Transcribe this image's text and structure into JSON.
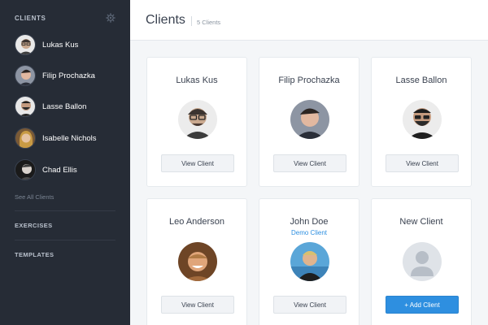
{
  "sidebar": {
    "title": "CLIENTS",
    "clients": [
      {
        "name": "Lukas Kus"
      },
      {
        "name": "Filip Prochazka"
      },
      {
        "name": "Lasse Ballon"
      },
      {
        "name": "Isabelle Nichols"
      },
      {
        "name": "Chad Ellis"
      }
    ],
    "see_all": "See All Clients",
    "sections": [
      {
        "label": "EXERCISES"
      },
      {
        "label": "TEMPLATES"
      }
    ]
  },
  "header": {
    "title": "Clients",
    "count": "5 Clients"
  },
  "cards": [
    {
      "name": "Lukas Kus",
      "sub": "",
      "button": "View Client"
    },
    {
      "name": "Filip Prochazka",
      "sub": "",
      "button": "View Client"
    },
    {
      "name": "Lasse Ballon",
      "sub": "",
      "button": "View Client"
    },
    {
      "name": "Leo Anderson",
      "sub": "",
      "button": "View Client"
    },
    {
      "name": "John Doe",
      "sub": "Demo Client",
      "button": "View Client"
    },
    {
      "name": "New Client",
      "sub": "",
      "button": "+ Add Client"
    }
  ],
  "colors": {
    "sidebar_bg": "#262c36",
    "accent": "#2e8fe0",
    "page_bg": "#f4f6f8"
  },
  "icons": {
    "settings": "gear-icon",
    "placeholder_avatar": "user-silhouette-icon"
  }
}
